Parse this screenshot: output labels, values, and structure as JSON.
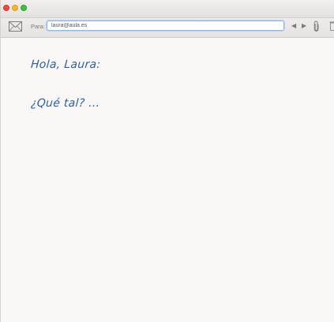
{
  "window": {
    "controls": [
      "close",
      "minimize",
      "zoom"
    ]
  },
  "toolbar": {
    "compose_icon": "envelope-icon",
    "to_label": "Para:",
    "to_value": "laura@aula.es",
    "prev_icon": "◀",
    "next_icon": "▶",
    "attach_icon": "paperclip-icon",
    "delete_icon": "trash-icon"
  },
  "message": {
    "greeting": "Hola, Laura:",
    "body": "¿Qué tal? ..."
  },
  "colors": {
    "ink": "#2f5ea1",
    "paper": "#faf8f6",
    "field_focus": "#8fb6e6"
  }
}
